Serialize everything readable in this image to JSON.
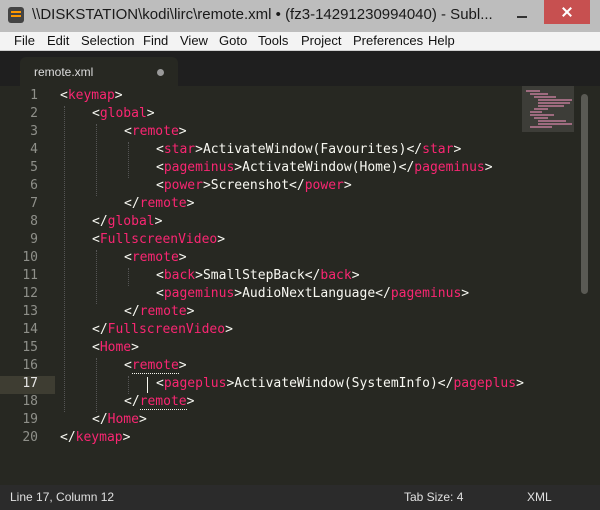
{
  "window": {
    "title": "\\\\DISKSTATION\\kodi\\lirc\\remote.xml • (fz3-14291230994040) - Subl..."
  },
  "menu": [
    "File",
    "Edit",
    "Selection",
    "Find",
    "View",
    "Goto",
    "Tools",
    "Project",
    "Preferences",
    "Help"
  ],
  "tab": {
    "label": "remote.xml"
  },
  "editor": {
    "active_line": 17,
    "line_numbers": [
      "1",
      "2",
      "3",
      "4",
      "5",
      "6",
      "7",
      "8",
      "9",
      "10",
      "11",
      "12",
      "13",
      "14",
      "15",
      "16",
      "17",
      "18",
      "19",
      "20"
    ],
    "lines": [
      {
        "indent": 0,
        "parts": [
          [
            "p",
            "<"
          ],
          [
            "t",
            "keymap"
          ],
          [
            "p",
            ">"
          ]
        ]
      },
      {
        "indent": 1,
        "parts": [
          [
            "p",
            "<"
          ],
          [
            "t",
            "global"
          ],
          [
            "p",
            ">"
          ]
        ]
      },
      {
        "indent": 2,
        "parts": [
          [
            "p",
            "<"
          ],
          [
            "t",
            "remote"
          ],
          [
            "p",
            ">"
          ]
        ]
      },
      {
        "indent": 3,
        "parts": [
          [
            "p",
            "<"
          ],
          [
            "t",
            "star"
          ],
          [
            "p",
            ">ActivateWindow(Favourites)</"
          ],
          [
            "t",
            "star"
          ],
          [
            "p",
            ">"
          ]
        ]
      },
      {
        "indent": 3,
        "parts": [
          [
            "p",
            "<"
          ],
          [
            "t",
            "pageminus"
          ],
          [
            "p",
            ">ActivateWindow(Home)</"
          ],
          [
            "t",
            "pageminus"
          ],
          [
            "p",
            ">"
          ]
        ]
      },
      {
        "indent": 3,
        "parts": [
          [
            "p",
            "<"
          ],
          [
            "t",
            "power"
          ],
          [
            "p",
            ">Screenshot</"
          ],
          [
            "t",
            "power"
          ],
          [
            "p",
            ">"
          ]
        ]
      },
      {
        "indent": 2,
        "parts": [
          [
            "p",
            "</"
          ],
          [
            "t",
            "remote"
          ],
          [
            "p",
            ">"
          ]
        ]
      },
      {
        "indent": 1,
        "parts": [
          [
            "p",
            "</"
          ],
          [
            "t",
            "global"
          ],
          [
            "p",
            ">"
          ]
        ]
      },
      {
        "indent": 1,
        "parts": [
          [
            "p",
            "<"
          ],
          [
            "t",
            "FullscreenVideo"
          ],
          [
            "p",
            ">"
          ]
        ]
      },
      {
        "indent": 2,
        "parts": [
          [
            "p",
            "<"
          ],
          [
            "t",
            "remote"
          ],
          [
            "p",
            ">"
          ]
        ]
      },
      {
        "indent": 3,
        "parts": [
          [
            "p",
            "<"
          ],
          [
            "t",
            "back"
          ],
          [
            "p",
            ">SmallStepBack</"
          ],
          [
            "t",
            "back"
          ],
          [
            "p",
            ">"
          ]
        ]
      },
      {
        "indent": 3,
        "parts": [
          [
            "p",
            "<"
          ],
          [
            "t",
            "pageminus"
          ],
          [
            "p",
            ">AudioNextLanguage</"
          ],
          [
            "t",
            "pageminus"
          ],
          [
            "p",
            ">"
          ]
        ]
      },
      {
        "indent": 2,
        "parts": [
          [
            "p",
            "</"
          ],
          [
            "t",
            "remote"
          ],
          [
            "p",
            ">"
          ]
        ]
      },
      {
        "indent": 1,
        "parts": [
          [
            "p",
            "</"
          ],
          [
            "t",
            "FullscreenVideo"
          ],
          [
            "p",
            ">"
          ]
        ]
      },
      {
        "indent": 1,
        "parts": [
          [
            "p",
            "<"
          ],
          [
            "t",
            "Home"
          ],
          [
            "p",
            ">"
          ]
        ]
      },
      {
        "indent": 2,
        "parts": [
          [
            "p",
            "<"
          ],
          [
            "t",
            "remote",
            "u"
          ],
          [
            "p",
            ">"
          ]
        ]
      },
      {
        "indent": 3,
        "parts": [
          [
            "p",
            "<"
          ],
          [
            "t",
            "pageplus"
          ],
          [
            "p",
            ">ActivateWindow(SystemInfo)</"
          ],
          [
            "t",
            "pageplus"
          ],
          [
            "p",
            ">"
          ]
        ]
      },
      {
        "indent": 2,
        "parts": [
          [
            "p",
            "</"
          ],
          [
            "t",
            "remote",
            "u"
          ],
          [
            "p",
            ">"
          ]
        ]
      },
      {
        "indent": 1,
        "parts": [
          [
            "p",
            "</"
          ],
          [
            "t",
            "Home"
          ],
          [
            "p",
            ">"
          ]
        ]
      },
      {
        "indent": 0,
        "parts": [
          [
            "p",
            "</"
          ],
          [
            "t",
            "keymap"
          ],
          [
            "p",
            ">"
          ]
        ]
      }
    ]
  },
  "colors": {
    "background": "#272822",
    "tag": "#f92672",
    "text": "#f8f8f2",
    "line_number": "#8f908a"
  },
  "status": {
    "position": "Line 17, Column 12",
    "tab_size": "Tab Size: 4",
    "syntax": "XML"
  }
}
